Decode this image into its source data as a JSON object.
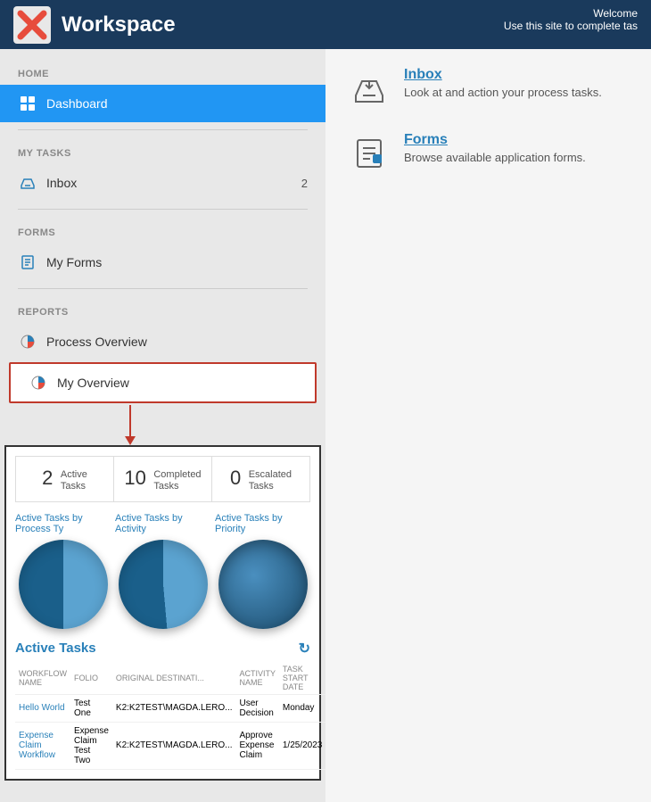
{
  "header": {
    "title": "Workspace",
    "welcome_line1": "Welcome",
    "welcome_line2": "Use this site to complete tas"
  },
  "sidebar": {
    "sections": [
      {
        "label": "HOME",
        "items": [
          {
            "id": "dashboard",
            "label": "Dashboard",
            "icon": "dashboard-icon",
            "active": true,
            "badge": ""
          }
        ]
      },
      {
        "label": "MY TASKS",
        "items": [
          {
            "id": "inbox",
            "label": "Inbox",
            "icon": "inbox-icon",
            "active": false,
            "badge": "2"
          }
        ]
      },
      {
        "label": "FORMS",
        "items": [
          {
            "id": "my-forms",
            "label": "My Forms",
            "icon": "forms-icon",
            "active": false,
            "badge": ""
          }
        ]
      },
      {
        "label": "REPORTS",
        "items": [
          {
            "id": "process-overview",
            "label": "Process Overview",
            "icon": "pie-icon",
            "active": false,
            "badge": ""
          },
          {
            "id": "my-overview",
            "label": "My Overview",
            "icon": "pie-icon",
            "active": false,
            "badge": "",
            "highlighted": true
          }
        ]
      }
    ]
  },
  "stats": [
    {
      "number": "2",
      "label_line1": "Active",
      "label_line2": "Tasks"
    },
    {
      "number": "10",
      "label_line1": "Completed",
      "label_line2": "Tasks"
    },
    {
      "number": "0",
      "label_line1": "Escalated",
      "label_line2": "Tasks"
    }
  ],
  "charts": [
    {
      "title": "Active Tasks by Process Ty",
      "type": "pie1"
    },
    {
      "title": "Active Tasks by Activity",
      "type": "pie2"
    },
    {
      "title": "Active Tasks by Priority",
      "type": "pie3"
    }
  ],
  "active_tasks": {
    "heading": "Active Tasks",
    "columns": [
      "WORKFLOW NAME",
      "FOLIO",
      "ORIGINAL DESTINATI...",
      "ACTIVITY NAME",
      "TASK START DATE",
      ""
    ],
    "rows": [
      {
        "workflow": "Hello World",
        "folio": "Test One",
        "original": "K2:K2TEST\\MAGDA.LERO...",
        "activity": "User Decision",
        "start_date": "Monday",
        "arrow": "›"
      },
      {
        "workflow": "Expense Claim Workflow",
        "folio": "Expense Claim Test Two",
        "original": "K2:K2TEST\\MAGDA.LERO...",
        "activity": "Approve Expense Claim",
        "start_date": "1/25/2023",
        "arrow": "›"
      }
    ]
  },
  "right_panel": {
    "items": [
      {
        "id": "inbox",
        "title": "Inbox",
        "description": "Look at and action your process tasks.",
        "icon": "inbox-icon"
      },
      {
        "id": "forms",
        "title": "Forms",
        "description": "Browse available application forms.",
        "icon": "forms-icon"
      }
    ]
  }
}
